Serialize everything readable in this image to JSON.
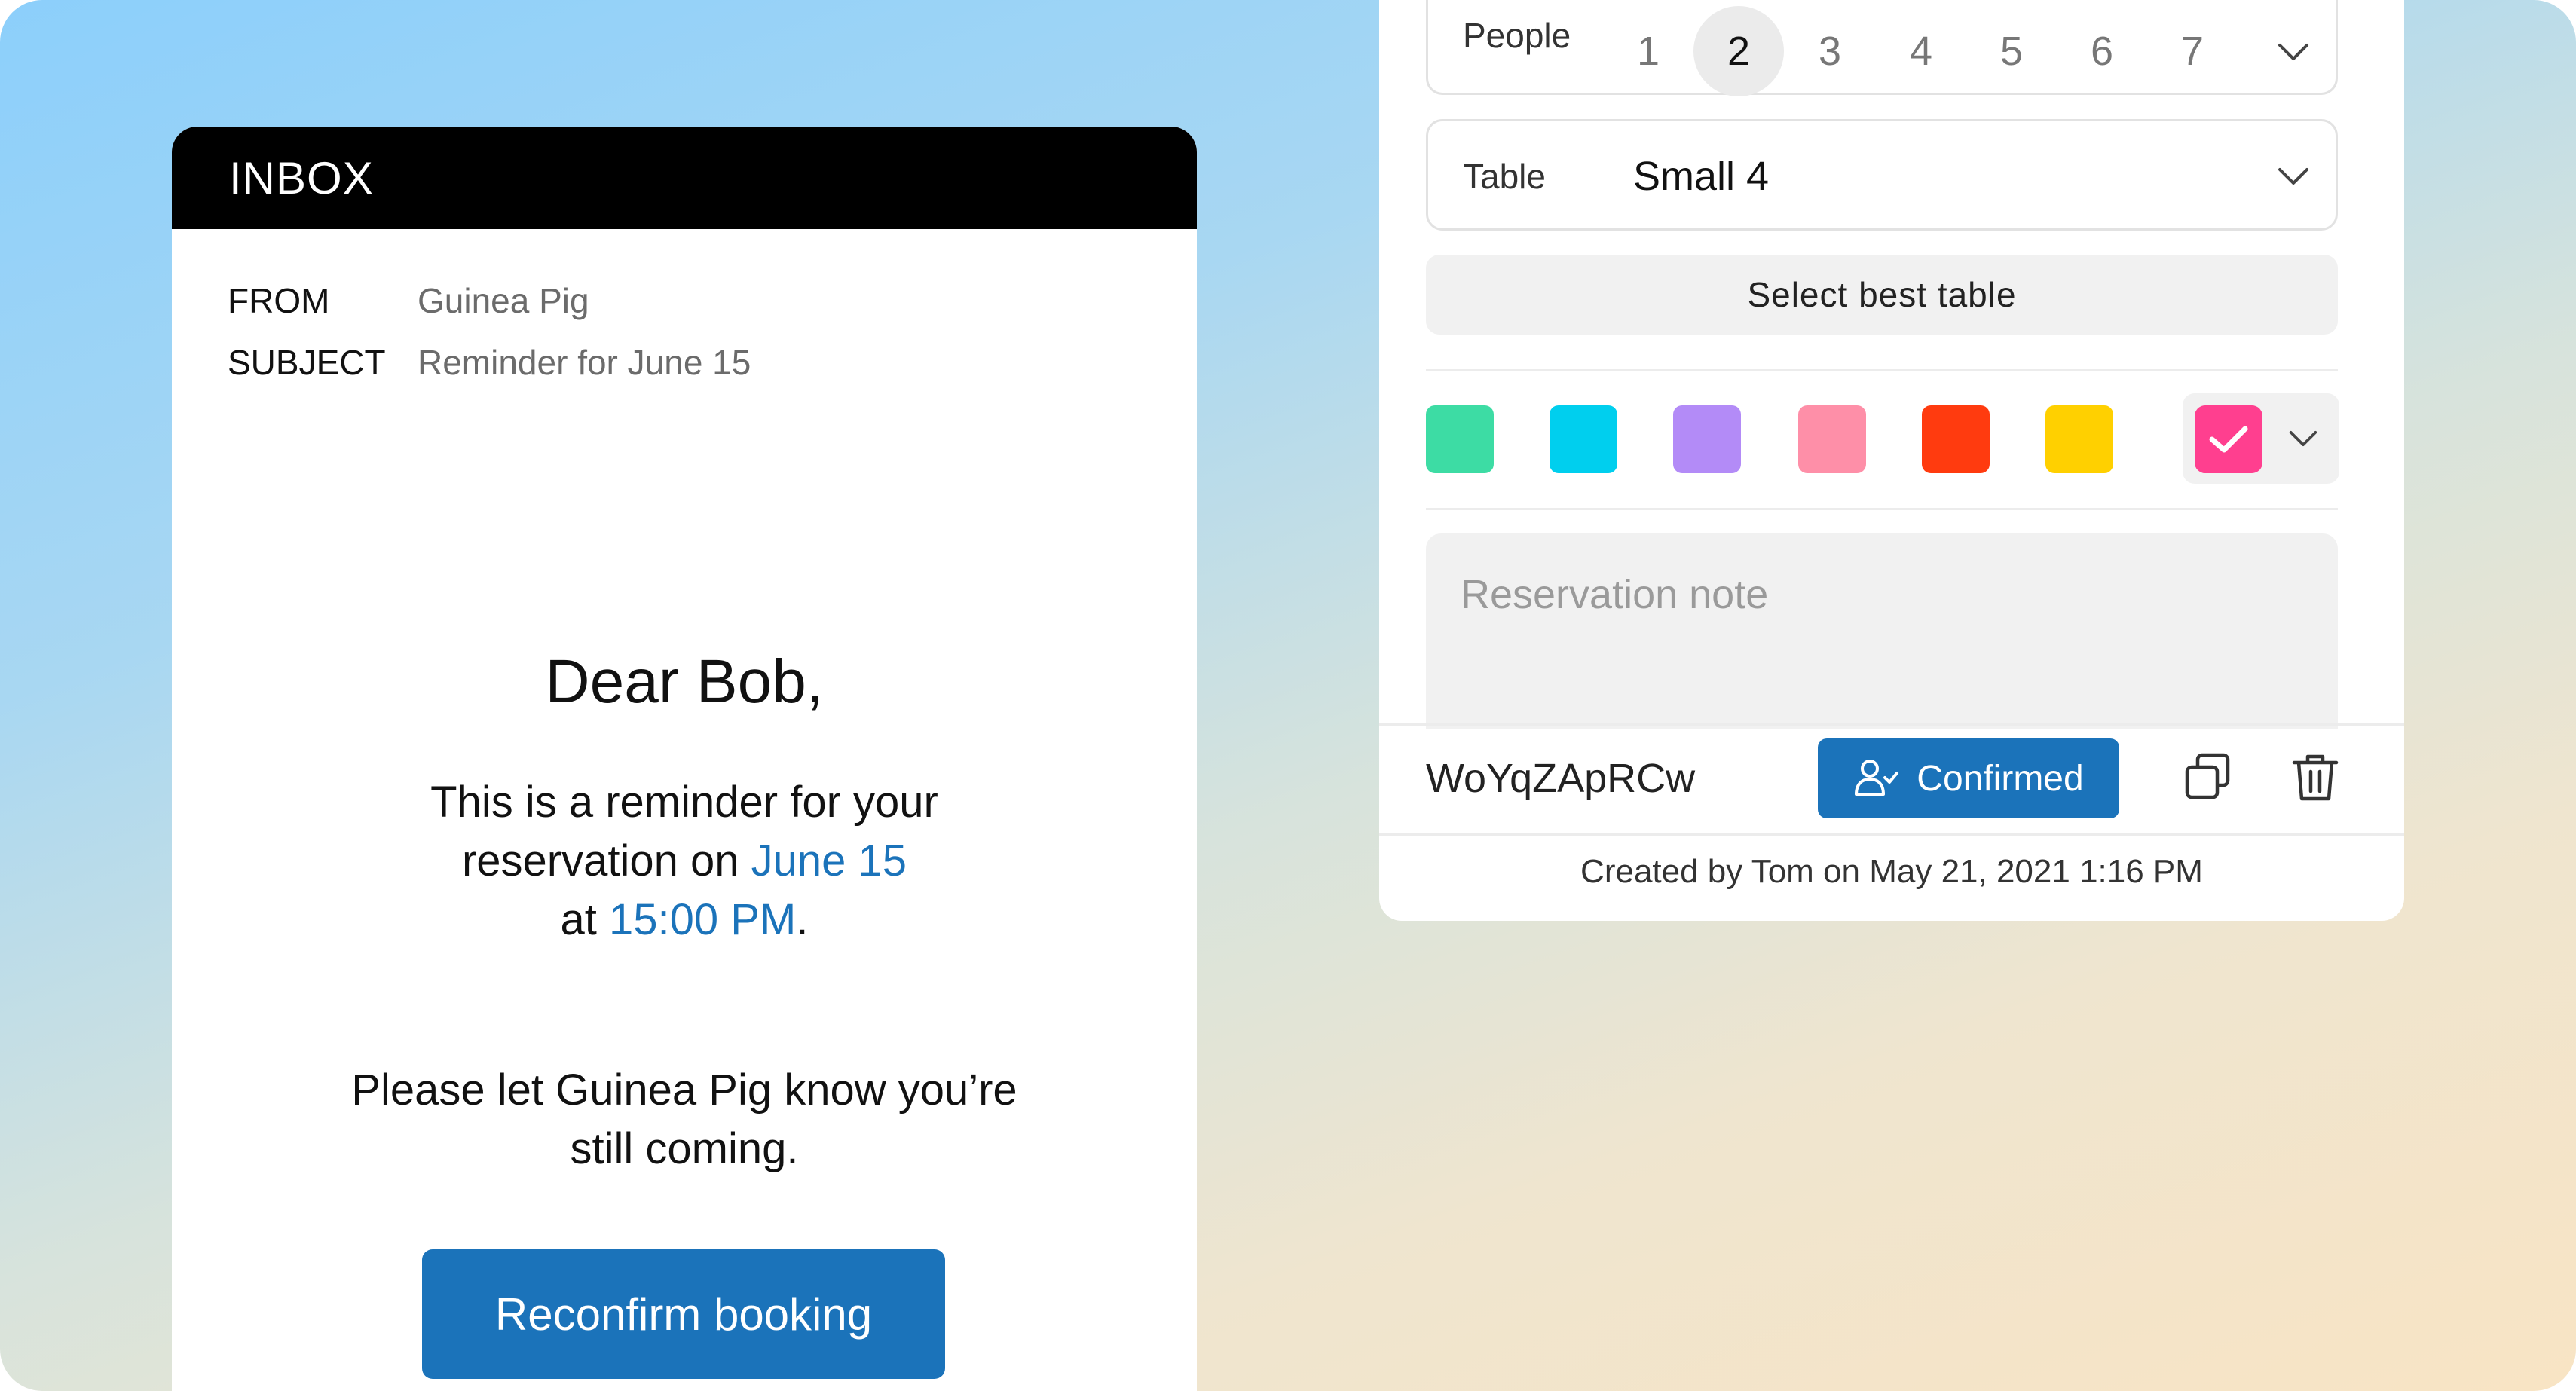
{
  "email": {
    "header_title": "INBOX",
    "from_label": "FROM",
    "from_value": "Guinea Pig",
    "subject_label": "SUBJECT",
    "subject_value": "Reminder for June 15",
    "greeting": "Dear Bob,",
    "body_line1": "This is a reminder for your",
    "body_line2_prefix": "reservation on ",
    "body_date": "June 15",
    "body_line3_prefix": "at ",
    "body_time": "15:00 PM",
    "body_line3_suffix": ".",
    "body2_line1": "Please let Guinea Pig know you’re",
    "body2_line2": "still coming.",
    "reconfirm_label": "Reconfirm booking",
    "link_color": "#1b73ba"
  },
  "reservation": {
    "people_label": "People",
    "people_options": [
      "1",
      "2",
      "3",
      "4",
      "5",
      "6",
      "7"
    ],
    "people_selected": "2",
    "table_label": "Table",
    "table_value": "Small 4",
    "best_table_label": "Select best table",
    "colors": [
      "#3ddca4",
      "#00cfee",
      "#b38bf7",
      "#fe8fa8",
      "#ff3b0f",
      "#ffd000"
    ],
    "selected_color": "#ff3f8f",
    "note_placeholder": "Reservation note",
    "code": "WoYqZApRCw",
    "status_label": "Confirmed",
    "created_text": "Created by Tom on May 21, 2021 1:16 PM",
    "icons": [
      "chevron-down-icon",
      "checkmark-icon",
      "user-check-icon",
      "copy-icon",
      "trash-icon"
    ]
  }
}
